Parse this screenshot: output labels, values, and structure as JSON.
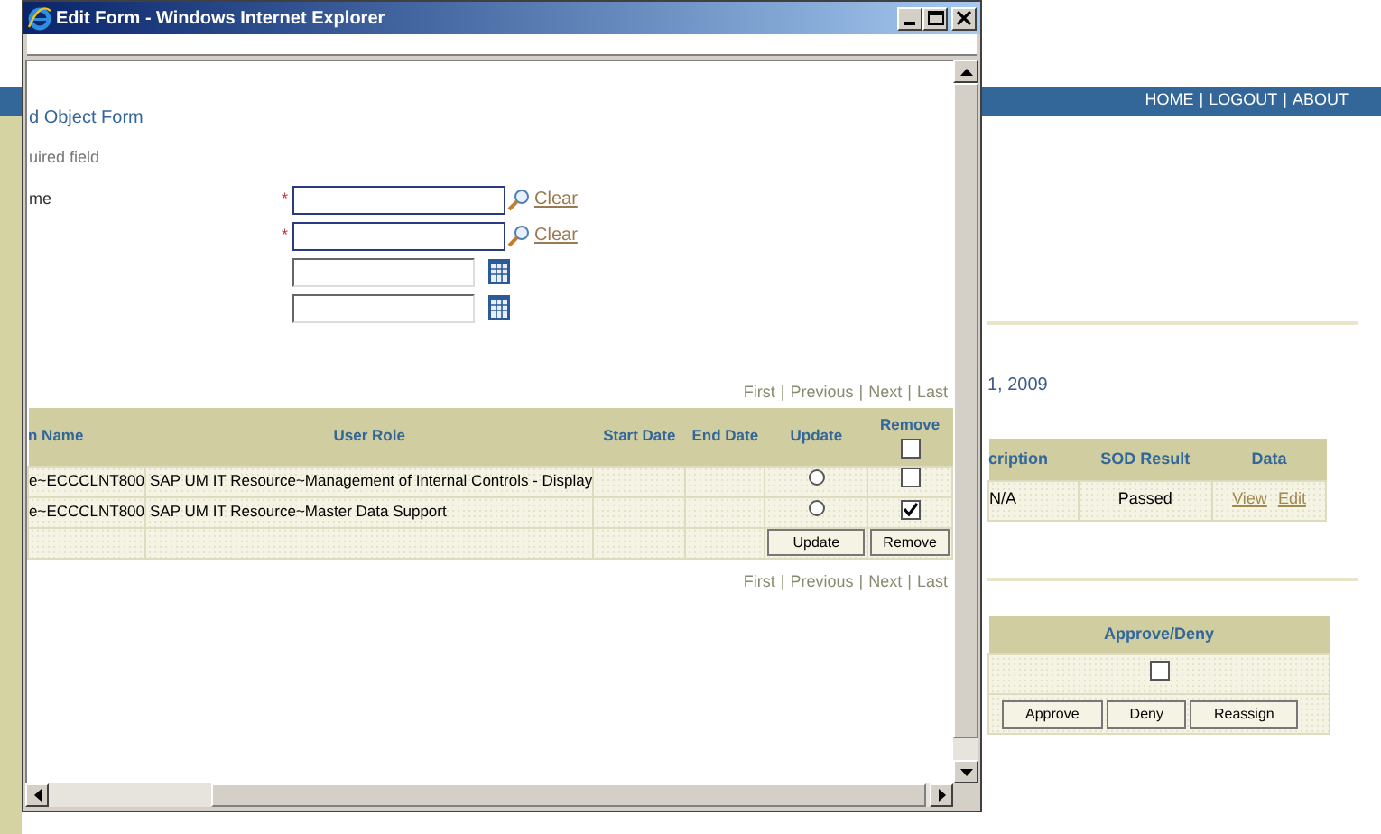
{
  "page": {
    "nav": [
      "HOME",
      "LOGOUT",
      "ABOUT"
    ],
    "nav_separator": "|",
    "date_text": "1, 2009",
    "result_table": {
      "columns": [
        "cription",
        "SOD Result",
        "Data"
      ],
      "rows": [
        {
          "description": "N/A",
          "sod_result": "Passed",
          "links": [
            "View",
            "Edit"
          ]
        }
      ]
    },
    "approval_table": {
      "column": "Approve/Deny",
      "checkbox": {
        "checked": false
      },
      "buttons": [
        "Approve",
        "Deny",
        "Reassign"
      ]
    }
  },
  "popup": {
    "title": "Edit Form - Windows Internet Explorer",
    "form_title": "d Object Form",
    "required_note": "uired field",
    "required_mark": "*",
    "fields": [
      {
        "kind": "lookup",
        "label": "me",
        "required": true,
        "link": "Clear"
      },
      {
        "kind": "lookup",
        "required": true,
        "link": "Clear"
      },
      {
        "kind": "date",
        "required": false
      },
      {
        "kind": "date",
        "required": false
      }
    ],
    "pager": {
      "links": [
        "First",
        "Previous",
        "Next",
        "Last"
      ],
      "separator": "|"
    },
    "table": {
      "columns": [
        "n Name",
        "User Role",
        "Start Date",
        "End Date",
        "Update",
        "Remove"
      ],
      "header_checkbox": {
        "checked": false
      },
      "rows": [
        {
          "name": "e~ECCCLNT800",
          "role": "SAP UM IT Resource~Management of Internal Controls - Display",
          "update": {
            "selected": false
          },
          "remove": {
            "checked": false
          }
        },
        {
          "name": "e~ECCCLNT800",
          "role": "SAP UM IT Resource~Master Data Support",
          "update": {
            "selected": false
          },
          "remove": {
            "checked": true
          }
        }
      ],
      "buttons": [
        "Update",
        "Remove"
      ]
    },
    "pager_bottom": {
      "links": [
        "First",
        "Previous",
        "Next",
        "Last"
      ],
      "separator": "|"
    }
  }
}
